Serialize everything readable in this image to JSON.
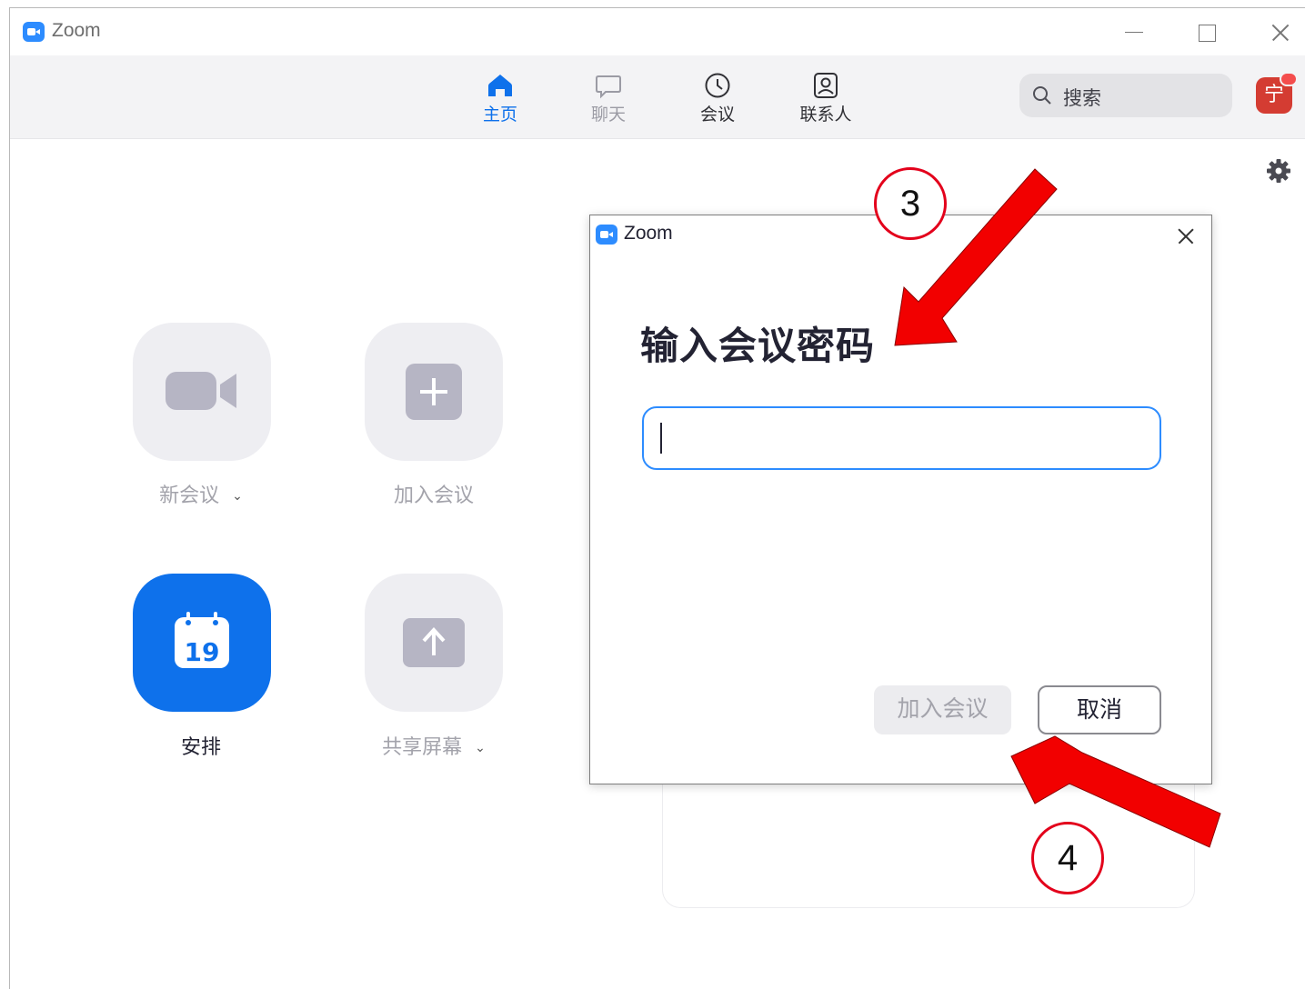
{
  "window": {
    "title": "Zoom",
    "controls": [
      "minimize",
      "maximize",
      "close"
    ]
  },
  "nav": {
    "items": [
      {
        "label": "主页",
        "icon": "home-icon",
        "active": true
      },
      {
        "label": "聊天",
        "icon": "chat-icon",
        "active": false
      },
      {
        "label": "会议",
        "icon": "clock-icon",
        "active": false
      },
      {
        "label": "联系人",
        "icon": "contacts-icon",
        "active": false
      }
    ],
    "search_placeholder": "搜索",
    "avatar_initial": "宁"
  },
  "home": {
    "tiles": [
      {
        "label": "新会议",
        "icon": "video-camera-icon",
        "has_dropdown": true
      },
      {
        "label": "加入会议",
        "icon": "plus-icon",
        "has_dropdown": false
      },
      {
        "label": "安排",
        "icon": "calendar-icon",
        "calendar_day": "19",
        "has_dropdown": false
      },
      {
        "label": "共享屏幕",
        "icon": "share-up-arrow-icon",
        "has_dropdown": true
      }
    ]
  },
  "dialog": {
    "title": "Zoom",
    "heading": "输入会议密码",
    "password_value": "",
    "join_label": "加入会议",
    "cancel_label": "取消"
  },
  "annotations": [
    {
      "number": "3"
    },
    {
      "number": "4"
    }
  ],
  "colors": {
    "accent": "#0e71eb",
    "annotation_red": "#e3001b",
    "tile_bg": "#eeeef2",
    "icon_gray": "#b6b5c4"
  }
}
